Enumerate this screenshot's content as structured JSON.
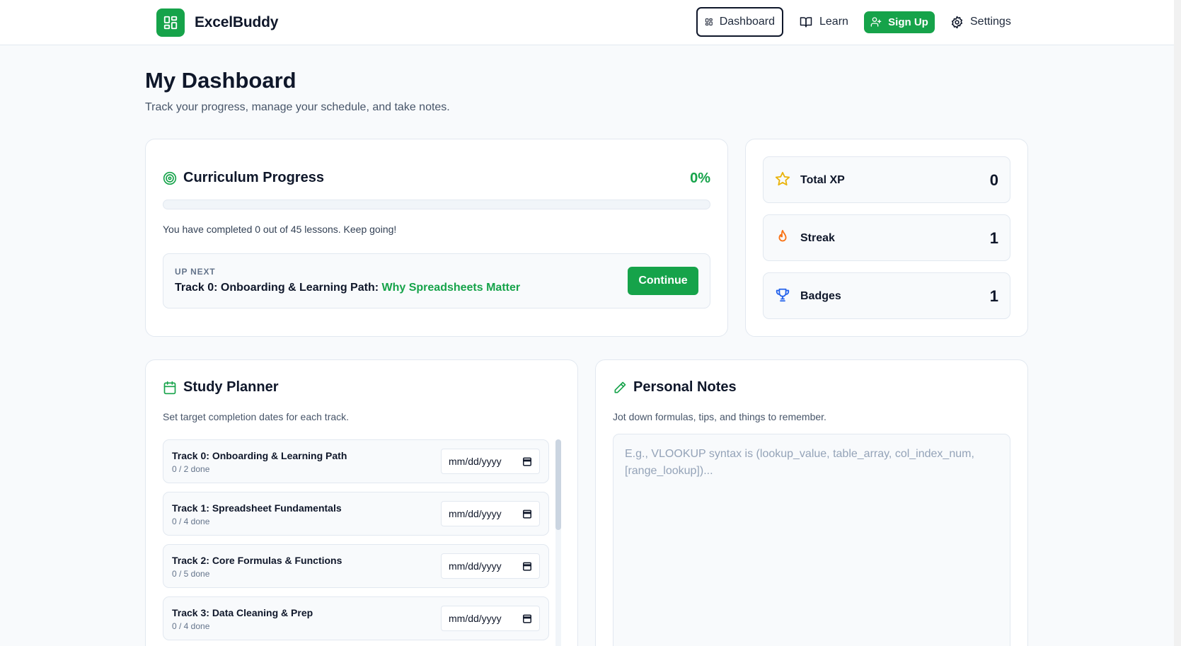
{
  "app": {
    "name": "ExcelBuddy",
    "logo_icon": "layout-grid-icon",
    "brand_color": "#16a34a"
  },
  "nav": {
    "dashboard": "Dashboard",
    "learn": "Learn",
    "signup": "Sign Up",
    "settings": "Settings"
  },
  "page": {
    "title": "My Dashboard",
    "subtitle": "Track your progress, manage your schedule, and take notes."
  },
  "progress": {
    "title": "Curriculum Progress",
    "percent_label": "0%",
    "percent": 0,
    "summary": "You have completed 0 out of 45 lessons. Keep going!",
    "up_next_label": "UP NEXT",
    "up_next_track": "Track 0: Onboarding & Learning Path:",
    "up_next_lesson": "Why Spreadsheets Matter",
    "continue_label": "Continue"
  },
  "stats": [
    {
      "label": "Total XP",
      "value": "0",
      "icon": "star-icon",
      "color": "#eab308"
    },
    {
      "label": "Streak",
      "value": "1",
      "icon": "flame-icon",
      "color": "#f97316"
    },
    {
      "label": "Badges",
      "value": "1",
      "icon": "trophy-icon",
      "color": "#2563eb"
    }
  ],
  "planner": {
    "title": "Study Planner",
    "description": "Set target completion dates for each track.",
    "tracks": [
      {
        "name": "Track 0: Onboarding & Learning Path",
        "done": "0 / 2 done",
        "date": "mm/dd/yyyy"
      },
      {
        "name": "Track 1: Spreadsheet Fundamentals",
        "done": "0 / 4 done",
        "date": "mm/dd/yyyy"
      },
      {
        "name": "Track 2: Core Formulas & Functions",
        "done": "0 / 5 done",
        "date": "mm/dd/yyyy"
      },
      {
        "name": "Track 3: Data Cleaning & Prep",
        "done": "0 / 4 done",
        "date": "mm/dd/yyyy"
      }
    ]
  },
  "notes": {
    "title": "Personal Notes",
    "description": "Jot down formulas, tips, and things to remember.",
    "placeholder": "E.g., VLOOKUP syntax is (lookup_value, table_array, col_index_num, [range_lookup])..."
  }
}
